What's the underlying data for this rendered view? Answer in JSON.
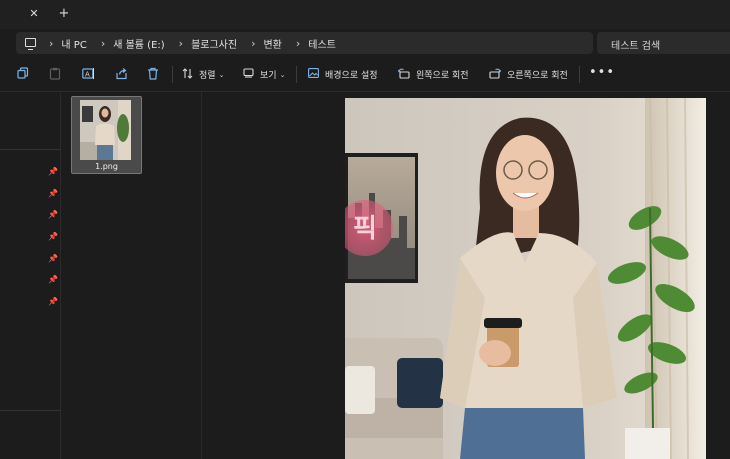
{
  "titlebar": {
    "close_glyph": "✕",
    "new_tab_glyph": "+"
  },
  "address": {
    "crumbs": [
      "내 PC",
      "새 볼륨 (E:)",
      "블로그사진",
      "변환",
      "테스트"
    ],
    "separator": "›"
  },
  "search": {
    "placeholder": "테스트 검색"
  },
  "commandbar": {
    "icons": [
      "copy-icon",
      "paste-icon",
      "rename-icon",
      "share-icon",
      "delete-icon"
    ],
    "sort_label": "정렬",
    "view_label": "보기",
    "set_background_label": "배경으로 설정",
    "rotate_left_label": "왼쪽으로 회전",
    "rotate_right_label": "오른쪽으로 회전",
    "more_glyph": "•••"
  },
  "files": [
    {
      "name": "1.png"
    }
  ],
  "preview": {
    "watermark_text": "픽"
  },
  "colors": {
    "accent": "#7db4e6",
    "background": "#1c1c1c",
    "selected_tile": "#4a4a4a"
  }
}
